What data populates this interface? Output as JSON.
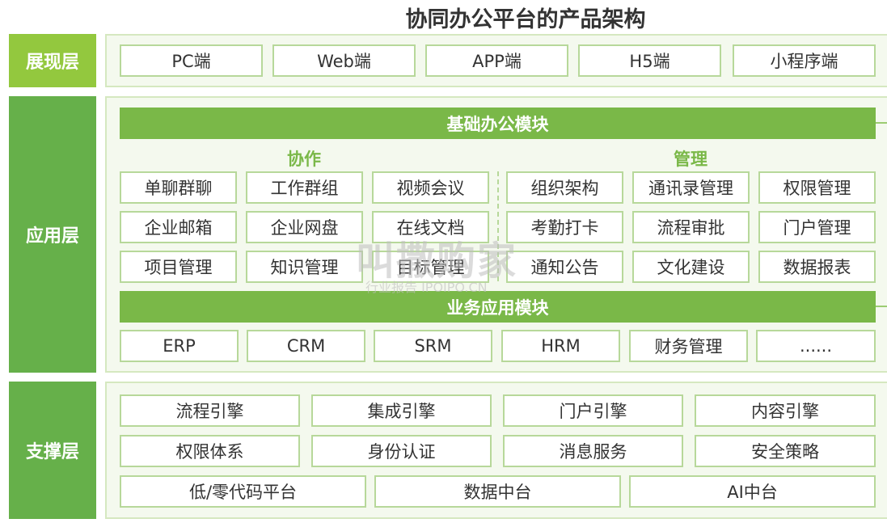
{
  "title": "协同办公平台的产品架构",
  "colors": {
    "label_light": "#93c83e",
    "label_dark": "#66b04a",
    "bar": "#7ab848",
    "border": "#b7d89a"
  },
  "presentation": {
    "label": "展现层",
    "items": [
      "PC端",
      "Web端",
      "APP端",
      "H5端",
      "小程序端"
    ]
  },
  "application": {
    "label": "应用层",
    "basic_bar": "基础办公模块",
    "collab_title": "协作",
    "collab_items": [
      "单聊群聊",
      "工作群组",
      "视频会议",
      "企业邮箱",
      "企业网盘",
      "在线文档",
      "项目管理",
      "知识管理",
      "目标管理"
    ],
    "manage_title": "管理",
    "manage_items": [
      "组织架构",
      "通讯录管理",
      "权限管理",
      "考勤打卡",
      "流程审批",
      "门户管理",
      "通知公告",
      "文化建设",
      "数据报表"
    ],
    "business_bar": "业务应用模块",
    "business_items": [
      "ERP",
      "CRM",
      "SRM",
      "HRM",
      "财务管理",
      "......"
    ]
  },
  "support": {
    "label": "支撑层",
    "row1": [
      "流程引擎",
      "集成引擎",
      "门户引擎",
      "内容引擎"
    ],
    "row2": [
      "权限体系",
      "身份认证",
      "消息服务",
      "安全策略"
    ],
    "row3": [
      "低/零代码平台",
      "数据中台",
      "AI中台"
    ]
  },
  "watermark": {
    "main": "叫撒购家",
    "sub": "行业报告 IPOIPO.CN"
  }
}
